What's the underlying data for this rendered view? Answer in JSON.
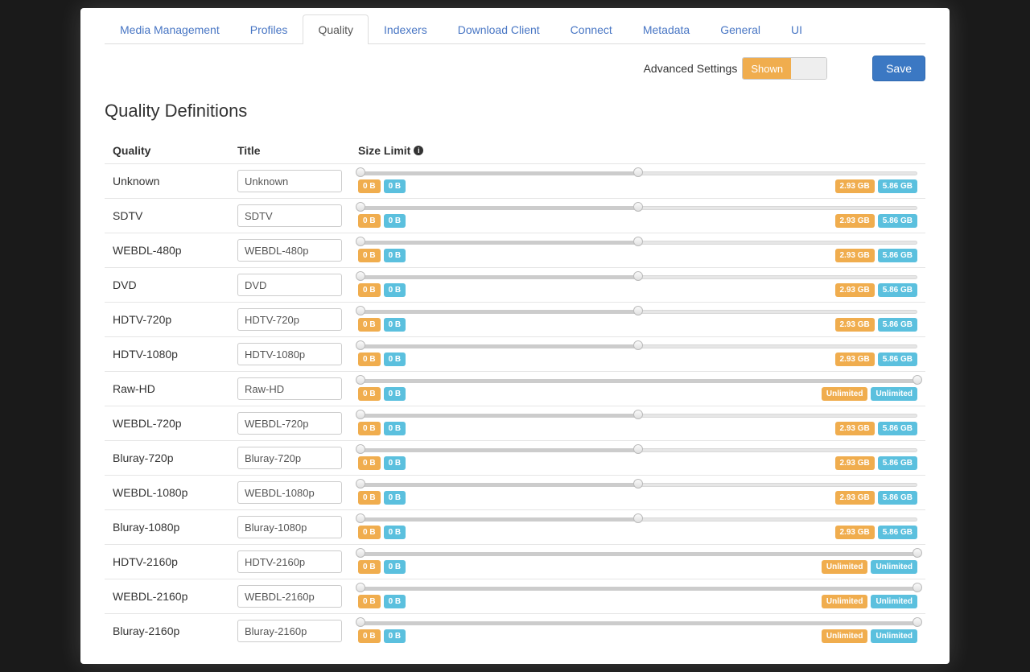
{
  "tabs": [
    {
      "label": "Media Management",
      "active": false
    },
    {
      "label": "Profiles",
      "active": false
    },
    {
      "label": "Quality",
      "active": true
    },
    {
      "label": "Indexers",
      "active": false
    },
    {
      "label": "Download Client",
      "active": false
    },
    {
      "label": "Connect",
      "active": false
    },
    {
      "label": "Metadata",
      "active": false
    },
    {
      "label": "General",
      "active": false
    },
    {
      "label": "UI",
      "active": false
    }
  ],
  "topbar": {
    "advanced_label": "Advanced Settings",
    "toggle_shown": "Shown",
    "save_label": "Save"
  },
  "heading": "Quality Definitions",
  "columns": {
    "quality": "Quality",
    "title": "Title",
    "size": "Size Limit"
  },
  "rows": [
    {
      "quality": "Unknown",
      "title": "Unknown",
      "min1": "0 B",
      "min2": "0 B",
      "max1": "2.93 GB",
      "max2": "5.86 GB",
      "handle": 50,
      "unlimited": false
    },
    {
      "quality": "SDTV",
      "title": "SDTV",
      "min1": "0 B",
      "min2": "0 B",
      "max1": "2.93 GB",
      "max2": "5.86 GB",
      "handle": 50,
      "unlimited": false
    },
    {
      "quality": "WEBDL-480p",
      "title": "WEBDL-480p",
      "min1": "0 B",
      "min2": "0 B",
      "max1": "2.93 GB",
      "max2": "5.86 GB",
      "handle": 50,
      "unlimited": false
    },
    {
      "quality": "DVD",
      "title": "DVD",
      "min1": "0 B",
      "min2": "0 B",
      "max1": "2.93 GB",
      "max2": "5.86 GB",
      "handle": 50,
      "unlimited": false
    },
    {
      "quality": "HDTV-720p",
      "title": "HDTV-720p",
      "min1": "0 B",
      "min2": "0 B",
      "max1": "2.93 GB",
      "max2": "5.86 GB",
      "handle": 50,
      "unlimited": false
    },
    {
      "quality": "HDTV-1080p",
      "title": "HDTV-1080p",
      "min1": "0 B",
      "min2": "0 B",
      "max1": "2.93 GB",
      "max2": "5.86 GB",
      "handle": 50,
      "unlimited": false
    },
    {
      "quality": "Raw-HD",
      "title": "Raw-HD",
      "min1": "0 B",
      "min2": "0 B",
      "max1": "Unlimited",
      "max2": "Unlimited",
      "handle": 100,
      "unlimited": true
    },
    {
      "quality": "WEBDL-720p",
      "title": "WEBDL-720p",
      "min1": "0 B",
      "min2": "0 B",
      "max1": "2.93 GB",
      "max2": "5.86 GB",
      "handle": 50,
      "unlimited": false
    },
    {
      "quality": "Bluray-720p",
      "title": "Bluray-720p",
      "min1": "0 B",
      "min2": "0 B",
      "max1": "2.93 GB",
      "max2": "5.86 GB",
      "handle": 50,
      "unlimited": false
    },
    {
      "quality": "WEBDL-1080p",
      "title": "WEBDL-1080p",
      "min1": "0 B",
      "min2": "0 B",
      "max1": "2.93 GB",
      "max2": "5.86 GB",
      "handle": 50,
      "unlimited": false
    },
    {
      "quality": "Bluray-1080p",
      "title": "Bluray-1080p",
      "min1": "0 B",
      "min2": "0 B",
      "max1": "2.93 GB",
      "max2": "5.86 GB",
      "handle": 50,
      "unlimited": false
    },
    {
      "quality": "HDTV-2160p",
      "title": "HDTV-2160p",
      "min1": "0 B",
      "min2": "0 B",
      "max1": "Unlimited",
      "max2": "Unlimited",
      "handle": 100,
      "unlimited": true
    },
    {
      "quality": "WEBDL-2160p",
      "title": "WEBDL-2160p",
      "min1": "0 B",
      "min2": "0 B",
      "max1": "Unlimited",
      "max2": "Unlimited",
      "handle": 100,
      "unlimited": true
    },
    {
      "quality": "Bluray-2160p",
      "title": "Bluray-2160p",
      "min1": "0 B",
      "min2": "0 B",
      "max1": "Unlimited",
      "max2": "Unlimited",
      "handle": 100,
      "unlimited": true
    }
  ]
}
